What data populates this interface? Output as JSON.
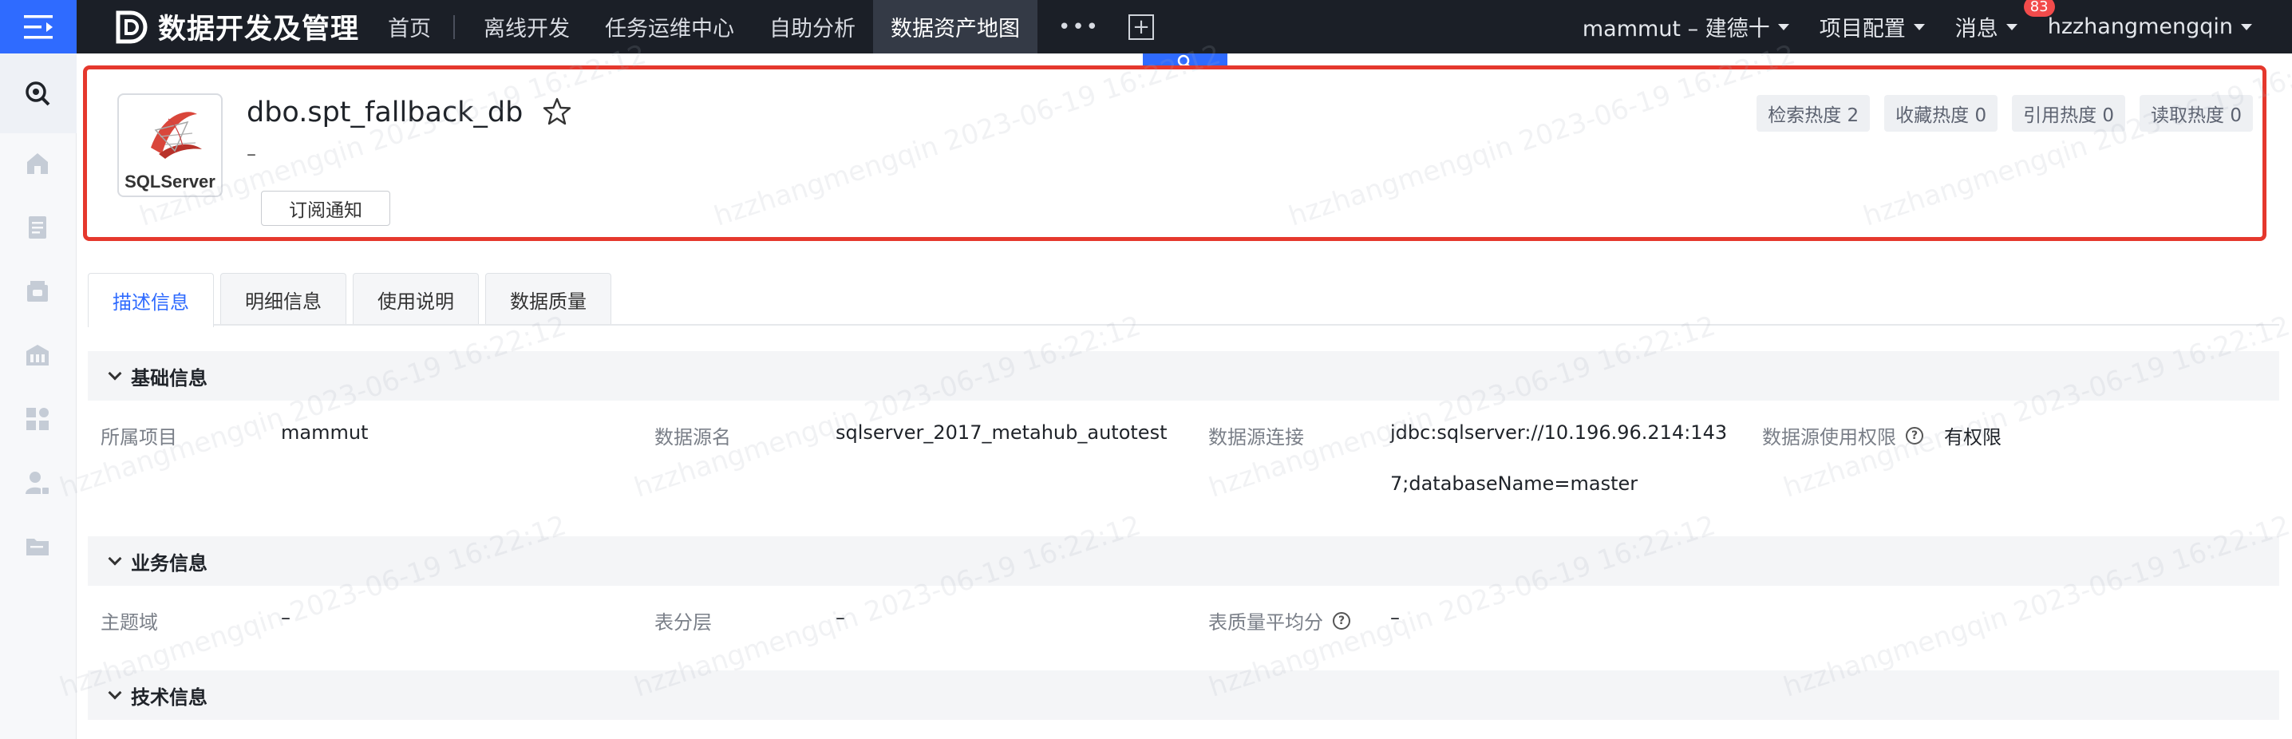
{
  "app": {
    "title": "数据开发及管理",
    "icons": {
      "menu": "menu-icon",
      "logo": "logo-d-icon"
    }
  },
  "nav": {
    "items": [
      "首页",
      "离线开发",
      "任务运维中心",
      "自助分析",
      "数据资产地图"
    ],
    "active_index": 4,
    "more": "•••",
    "add": "+"
  },
  "header_right": {
    "project": "mammut – 建德十",
    "project_config": "项目配置",
    "messages": "消息",
    "messages_badge": "83",
    "user": "hzzhangmengqin"
  },
  "asset": {
    "logo_text": "SQLServer",
    "title": "dbo.spt_fallback_db",
    "description": "–",
    "subscribe": "订阅通知",
    "stats": [
      "检索热度 2",
      "收藏热度 0",
      "引用热度 0",
      "读取热度 0"
    ]
  },
  "tabs": [
    "描述信息",
    "明细信息",
    "使用说明",
    "数据质量"
  ],
  "active_tab": 0,
  "sections": {
    "basic": {
      "title": "基础信息",
      "project_label": "所属项目",
      "project_value": "mammut",
      "source_label": "数据源名",
      "source_value": "sqlserver_2017_metahub_autotest",
      "conn_label": "数据源连接",
      "conn_value_1": "jdbc:sqlserver://10.196.96.214:143",
      "conn_value_2": "7;databaseName=master",
      "perm_label": "数据源使用权限",
      "perm_value": "有权限"
    },
    "business": {
      "title": "业务信息",
      "domain_label": "主题域",
      "domain_value": "–",
      "layer_label": "表分层",
      "layer_value": "–",
      "quality_label": "表质量平均分",
      "quality_value": "–"
    },
    "tech": {
      "title": "技术信息"
    }
  },
  "watermark": "hzzhangmengqin 2023-06-19 16:22:12",
  "colors": {
    "accent": "#2f6bff",
    "highlight_border": "#e5382d",
    "topbar": "#1b1f27",
    "badge": "#f24b4b"
  }
}
